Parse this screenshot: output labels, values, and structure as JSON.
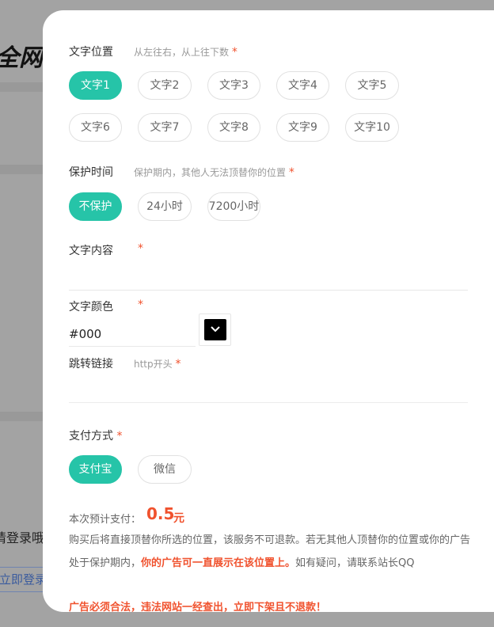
{
  "background": {
    "logo_fragment": "全网",
    "login_prompt": "请登录哦",
    "login_link": "立即登录"
  },
  "text_position": {
    "label": "文字位置",
    "hint": "从左往右，从上往下数",
    "required_mark": "*",
    "options": [
      "文字1",
      "文字2",
      "文字3",
      "文字4",
      "文字5",
      "文字6",
      "文字7",
      "文字8",
      "文字9",
      "文字10"
    ],
    "selected": "文字1"
  },
  "protection": {
    "label": "保护时间",
    "hint": "保护期内，其他人无法顶替你的位置",
    "required_mark": "*",
    "options": [
      "不保护",
      "24小时",
      "7200小时"
    ],
    "selected": "不保护"
  },
  "text_content": {
    "label": "文字内容",
    "required_mark": "*",
    "value": ""
  },
  "text_color": {
    "label": "文字颜色",
    "required_mark": "*",
    "value": "#000",
    "swatch_color": "#000000",
    "picker_icon": "chevron-down-icon"
  },
  "link": {
    "label": "跳转链接",
    "hint": "http开头",
    "required_mark": "*",
    "value": ""
  },
  "payment": {
    "label": "支付方式",
    "required_mark": "*",
    "options": [
      "支付宝",
      "微信"
    ],
    "selected": "支付宝"
  },
  "price": {
    "label": "本次预计支付：",
    "amount": "0.5",
    "unit": "元"
  },
  "notice": {
    "part1": "购买后将直接顶替你所选的位置，该服务不可退款。若无其他人顶替你的位置或你的广告处于保护期内，",
    "highlight": "你的广告可一直展示在该位置上。",
    "part2": "如有疑问，请联系站长QQ"
  },
  "warning": "广告必须合法，违法网站一经查出，立即下架且不退款！",
  "colors": {
    "accent": "#26c4a8",
    "required": "#f0522e"
  }
}
